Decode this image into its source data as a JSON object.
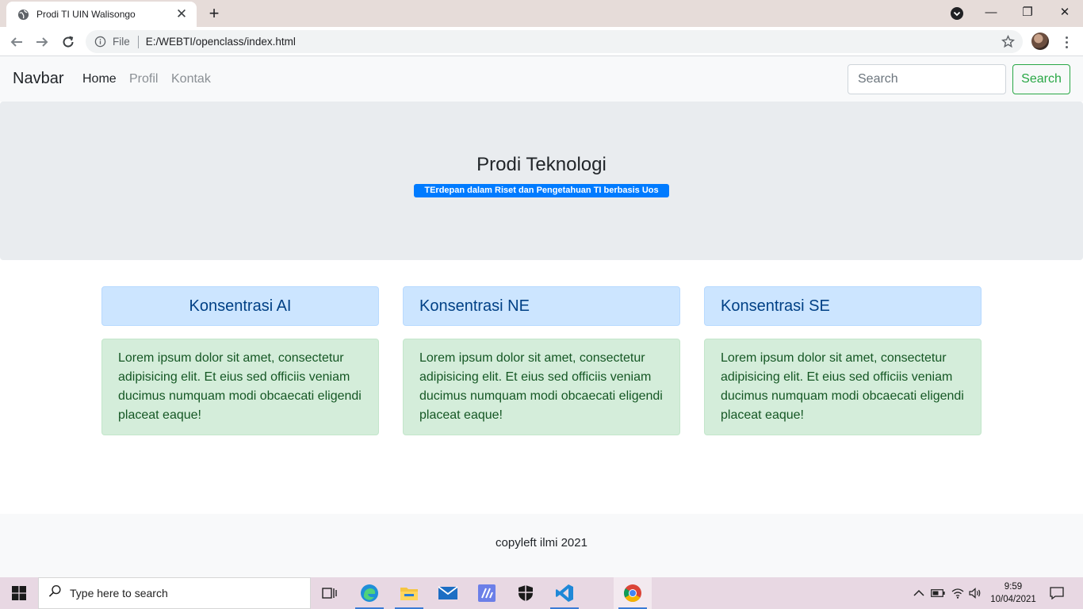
{
  "browser": {
    "tab_title": "Prodi TI UIN Walisongo",
    "tab_close": "✕",
    "new_tab": "+",
    "omnibox_scheme": "File",
    "omnibox_url": "E:/WEBTI/openclass/index.html",
    "window_minimize": "—",
    "window_restore": "❐",
    "window_close": "✕"
  },
  "navbar": {
    "brand": "Navbar",
    "links": [
      "Home",
      "Profil",
      "Kontak"
    ],
    "search_placeholder": "Search",
    "search_button": "Search"
  },
  "jumbotron": {
    "title": "Prodi Teknologi",
    "badge": "TErdepan dalam Riset dan Pengetahuan TI berbasis Uos"
  },
  "cards": [
    {
      "title": "Konsentrasi AI",
      "body": "Lorem ipsum dolor sit amet, consectetur adipisicing elit. Et eius sed officiis veniam ducimus numquam modi obcaecati eligendi placeat eaque!"
    },
    {
      "title": "Konsentrasi NE",
      "body": "Lorem ipsum dolor sit amet, consectetur adipisicing elit. Et eius sed officiis veniam ducimus numquam modi obcaecati eligendi placeat eaque!"
    },
    {
      "title": "Konsentrasi SE",
      "body": "Lorem ipsum dolor sit amet, consectetur adipisicing elit. Et eius sed officiis veniam ducimus numquam modi obcaecati eligendi placeat eaque!"
    }
  ],
  "footer": {
    "text": "copyleft ilmi 2021"
  },
  "taskbar": {
    "search_placeholder": "Type here to search",
    "time": "9:59",
    "date": "10/04/2021"
  },
  "colors": {
    "navbar_bg": "#f8f9fa",
    "jumbotron_bg": "#e9ecef",
    "badge_primary": "#007bff",
    "card_header_bg": "#cce5ff",
    "card_body_bg": "#d4edda",
    "search_button_accent": "#28a745"
  }
}
